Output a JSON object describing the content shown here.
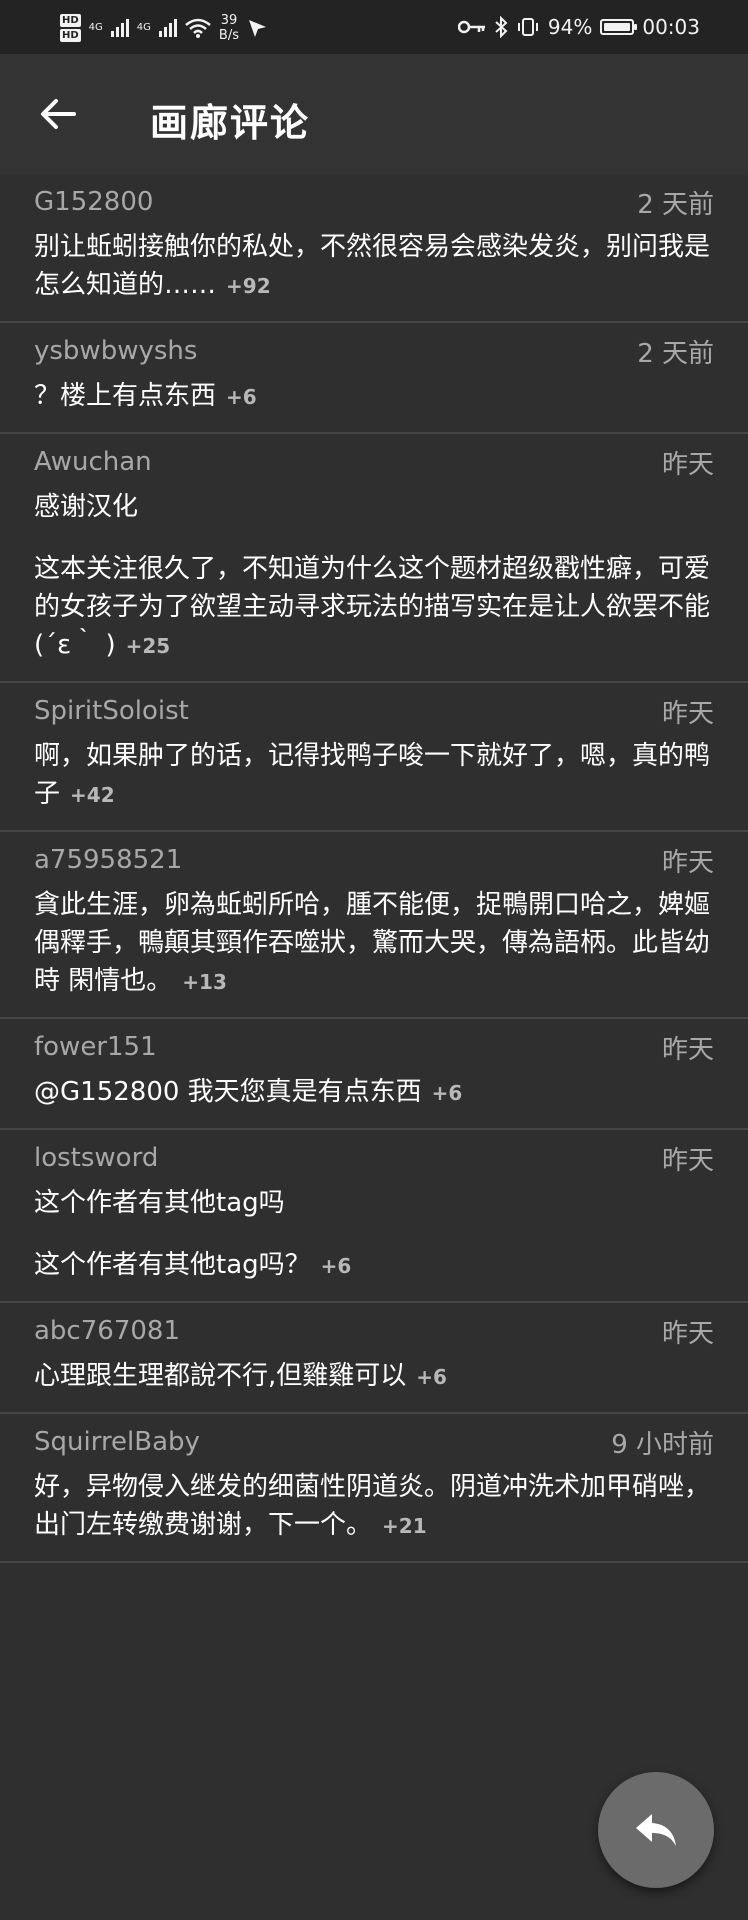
{
  "status_bar": {
    "hd1": "HD",
    "hd2": "HD",
    "net1": "4G",
    "net2": "4G",
    "speed_value": "39",
    "speed_unit": "B/s",
    "battery_text": "94%",
    "time": "00:03"
  },
  "app_bar": {
    "title": "画廊评论"
  },
  "comments": [
    {
      "user": "G152800",
      "time": "2 天前",
      "paragraphs": [
        "别让蚯蚓接触你的私处，不然很容易会感染发炎，别问我是怎么知道的……"
      ],
      "score": "+92"
    },
    {
      "user": "ysbwbwyshs",
      "time": "2 天前",
      "paragraphs": [
        "？楼上有点东西"
      ],
      "score": "+6"
    },
    {
      "user": "Awuchan",
      "time": "昨天",
      "paragraphs": [
        "感谢汉化",
        "这本关注很久了，不知道为什么这个题材超级戳性癖，可爱的女孩子为了欲望主动寻求玩法的描写实在是让人欲罢不能(´ε｀ )"
      ],
      "score": "+25"
    },
    {
      "user": "SpiritSoloist",
      "time": "昨天",
      "paragraphs": [
        "啊，如果肿了的话，记得找鸭子唆一下就好了，嗯，真的鸭子"
      ],
      "score": "+42"
    },
    {
      "user": "a75958521",
      "time": "昨天",
      "paragraphs": [
        "貪此生涯，卵為蚯蚓所哈，腫不能便，捉鴨開口哈之，婢嫗偶釋手，鴨顛其頸作吞噬狀，驚而大哭，傳為語柄。此皆幼時 閑情也。"
      ],
      "score": "+13"
    },
    {
      "user": "fower151",
      "time": "昨天",
      "paragraphs": [
        "@G152800 我天您真是有点东西"
      ],
      "score": "+6"
    },
    {
      "user": "lostsword",
      "time": "昨天",
      "paragraphs": [
        "这个作者有其他tag吗",
        "这个作者有其他tag吗？"
      ],
      "score": "+6"
    },
    {
      "user": "abc767081",
      "time": "昨天",
      "paragraphs": [
        "心理跟生理都說不行,但雞雞可以"
      ],
      "score": "+6"
    },
    {
      "user": "SquirrelBaby",
      "time": "9 小时前",
      "paragraphs": [
        "好，异物侵入继发的细菌性阴道炎。阴道冲洗术加甲硝唑，出门左转缴费谢谢，下一个。"
      ],
      "score": "+21"
    }
  ],
  "icons": {
    "back": "arrow-left-icon",
    "reply": "reply-icon"
  }
}
